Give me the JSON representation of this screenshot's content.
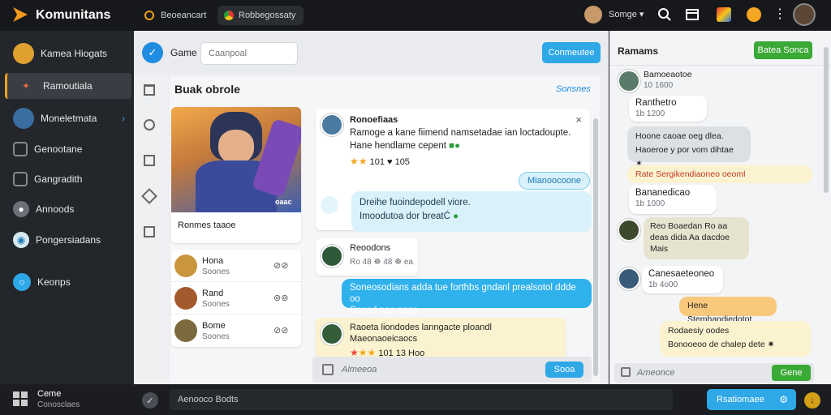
{
  "app": {
    "name": "Komunitans",
    "tab1": "Beoeancart",
    "tab2": "Robbegossaty",
    "user_label": "Somge"
  },
  "sidebar": {
    "items": [
      {
        "label": "Kamea Hiogats"
      },
      {
        "label": "Ramoutiala"
      },
      {
        "label": "Moneletmata"
      },
      {
        "label": "Genootane"
      },
      {
        "label": "Gangradith"
      },
      {
        "label": "Annoods"
      },
      {
        "label": "Pongersiadans"
      },
      {
        "label": "Keonps"
      }
    ],
    "bottom_title": "Ceme",
    "bottom_sub": "Conosclaes"
  },
  "main": {
    "game_label": "Game",
    "search_placeholder": "Caanpoal",
    "header_button": "Conmeutee",
    "section_title": "Buak obrole",
    "section_link": "Sonsnes",
    "hero_badge": "oaac",
    "hero_caption": "Ronmes taaoe",
    "game_list": [
      {
        "title": "Hona",
        "sub": "Soones"
      },
      {
        "title": "Rand",
        "sub": "Soones"
      },
      {
        "title": "Bome",
        "sub": "Soones"
      }
    ],
    "post": {
      "author": "Ronoefiaas",
      "line1": "Ramoge a kane fiimend namsetadae ian loctadoupte.",
      "line2": "Hane hendlame cepent",
      "stats": "101  ♥ 105"
    },
    "reply_chip": "Mianoocoone",
    "notice_line1": "Dreihe fuoindepodell viore.",
    "notice_line2": "Imoodutoa dor breatĆ",
    "chat_card": {
      "name": "Reoodons",
      "meta": "Ro 48 ☸ 48 ☸ ea"
    },
    "blue_msg_line1": "Soneosodians adda tue forthbs gndanl prealsotol ddde oo",
    "blue_msg_line2": "Snond nae eaga.",
    "yellow_post": {
      "line1": "Raoeta liondodes lanngacte ploandl",
      "line2": "Maeonaoeicaocs",
      "stats": "101  13 Hoo"
    },
    "composer_placeholder": "Almeeoa",
    "composer_send": "Sooa"
  },
  "right": {
    "title": "Ramams",
    "button": "Batea Sonca",
    "messages": [
      {
        "text": "Bamoeaotoe",
        "meta": "10 1600"
      },
      {
        "text": "Ranthetro ",
        "meta": "1b 1200"
      },
      {
        "text": "Hoone caoae oeg dlea. Haoeroe y por vom dihtae ✶"
      },
      {
        "text": "Rate Sergikendiaoneo oeoml"
      },
      {
        "text": "Bananedicao ",
        "meta": "1b 1000"
      },
      {
        "text": "Reo Boaedan Ro aa deas dida Aa dacdoe Mais"
      },
      {
        "text": "Canesaeteoneo",
        "meta": "1b 4o00"
      },
      {
        "text": "Hene Stemhandiedotot"
      },
      {
        "text": "Rodaesiy oodes",
        "line2": "Bonooeoo de chalep dete ✷"
      }
    ],
    "composer_placeholder": "Ameonce",
    "composer_button": "Gene"
  },
  "bottom": {
    "input_placeholder": "Aenooco Bodts",
    "button": "Rsatiomaee"
  },
  "colors": {
    "accent": "#2fa8e8",
    "green": "#3aa935",
    "active_marker": "#f0a21a"
  }
}
